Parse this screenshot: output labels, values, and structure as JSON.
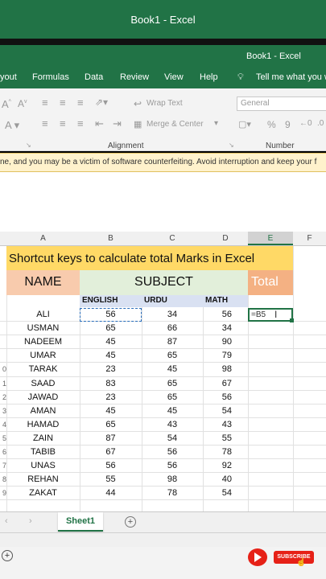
{
  "window": {
    "outer_title": "Book1  -  Excel",
    "inner_title": "Book1  -  Excel"
  },
  "tabs": [
    "yout",
    "Formulas",
    "Data",
    "Review",
    "View",
    "Help"
  ],
  "tell_me": "Tell me what you w",
  "ribbon": {
    "wrap_text": "Wrap Text",
    "merge_center": "Merge & Center",
    "number_format": "General",
    "alignment_label": "Alignment",
    "number_label": "Number",
    "percent": "%",
    "comma": "9"
  },
  "warning": "ne, and you may be a victim of software counterfeiting. Avoid interruption and keep your f",
  "columns": [
    "A",
    "B",
    "C",
    "D",
    "E",
    "F"
  ],
  "sheet": {
    "title": "Shortcut keys to calculate total Marks in Excel",
    "name_header": "NAME",
    "subject_header": "SUBJECT",
    "total_header": "Total",
    "sub_headers": [
      "ENGLISH",
      "URDU",
      "MATH"
    ],
    "active_formula": "=B5",
    "rows": [
      {
        "name": "ALI",
        "english": "56",
        "urdu": "34",
        "math": "56"
      },
      {
        "name": "USMAN",
        "english": "65",
        "urdu": "66",
        "math": "34"
      },
      {
        "name": "NADEEM",
        "english": "45",
        "urdu": "87",
        "math": "90"
      },
      {
        "name": "UMAR",
        "english": "45",
        "urdu": "65",
        "math": "79"
      },
      {
        "name": "TARAK",
        "english": "23",
        "urdu": "45",
        "math": "98"
      },
      {
        "name": "SAAD",
        "english": "83",
        "urdu": "65",
        "math": "67"
      },
      {
        "name": "JAWAD",
        "english": "23",
        "urdu": "65",
        "math": "56"
      },
      {
        "name": "AMAN",
        "english": "45",
        "urdu": "45",
        "math": "54"
      },
      {
        "name": "HAMAD",
        "english": "65",
        "urdu": "43",
        "math": "43"
      },
      {
        "name": "ZAIN",
        "english": "87",
        "urdu": "54",
        "math": "55"
      },
      {
        "name": "TABIB",
        "english": "67",
        "urdu": "56",
        "math": "78"
      },
      {
        "name": "UNAS",
        "english": "56",
        "urdu": "56",
        "math": "92"
      },
      {
        "name": "REHAN",
        "english": "55",
        "urdu": "98",
        "math": "40"
      },
      {
        "name": "ZAKAT",
        "english": "44",
        "urdu": "78",
        "math": "54"
      }
    ],
    "row_numbers": [
      "",
      "",
      "",
      "",
      "0",
      "1",
      "2",
      "3",
      "4",
      "5",
      "6",
      "7",
      "8",
      "9"
    ]
  },
  "sheet_tab": "Sheet1",
  "subscribe": "SUBSCRIBE",
  "colors": {
    "excel_green": "#217346",
    "title_fill": "#ffd966",
    "name_fill": "#f8cbad",
    "subject_fill": "#e2efda",
    "total_fill": "#f4b183",
    "sub_fill": "#d9e1f2"
  }
}
